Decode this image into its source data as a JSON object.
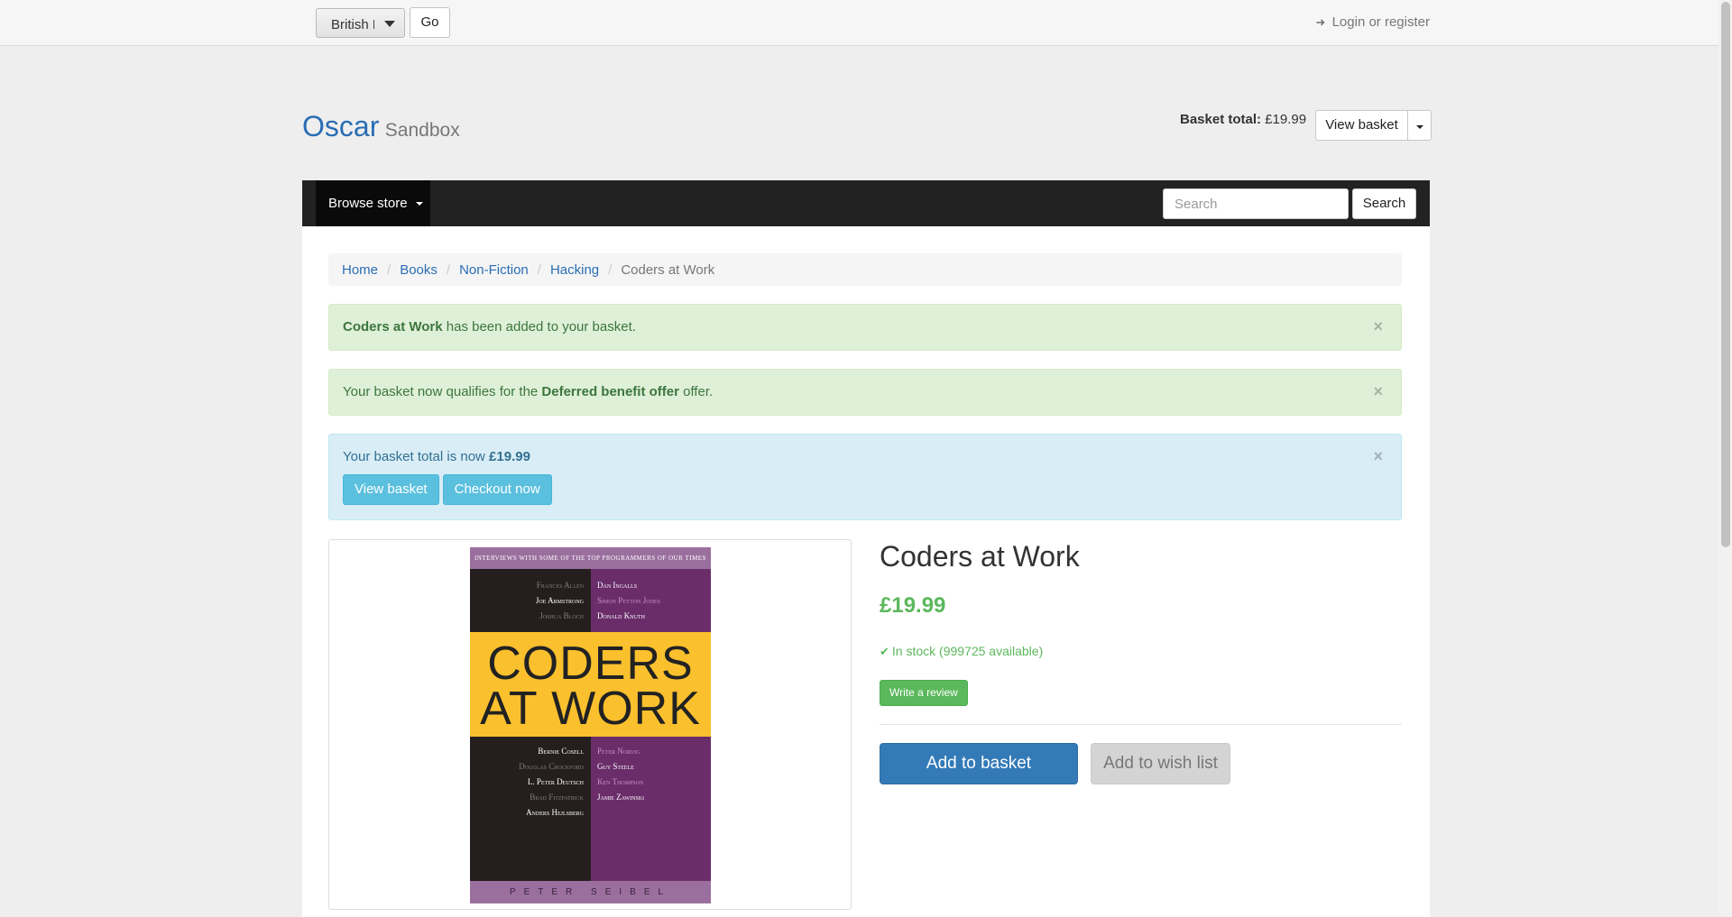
{
  "topbar": {
    "language_value": "British E",
    "go_label": "Go",
    "login_label": "Login or register"
  },
  "brand": {
    "name": "Oscar",
    "sub": "Sandbox"
  },
  "basket": {
    "total_label": "Basket total:",
    "total_value": "£19.99",
    "view_basket_label": "View basket"
  },
  "nav": {
    "browse_label": "Browse store",
    "search_placeholder": "Search",
    "search_button": "Search"
  },
  "breadcrumb": {
    "items": [
      "Home",
      "Books",
      "Non-Fiction",
      "Hacking"
    ],
    "active": "Coders at Work"
  },
  "alerts": {
    "added": {
      "strong": "Coders at Work",
      "text": " has been added to your basket."
    },
    "offer": {
      "pre": "Your basket now qualifies for the ",
      "strong": "Deferred benefit offer",
      "post": " offer."
    },
    "total": {
      "pre": "Your basket total is now ",
      "strong": "£19.99",
      "view_basket": "View basket",
      "checkout": "Checkout now"
    },
    "close": "×"
  },
  "cover": {
    "tagline": "INTERVIEWS WITH SOME OF THE TOP PROGRAMMERS OF OUR TIMES",
    "top_left": [
      "Frances Allen",
      "Joe Armstrong",
      "Joshua Bloch"
    ],
    "top_right": [
      "Dan Ingalls",
      "Simon Peyton Jones",
      "Donald Knuth"
    ],
    "title_line1": "CODERS",
    "title_line2": "AT WORK",
    "bottom_left": [
      "Bernie Cosell",
      "Douglas Crockford",
      "L. Peter Deutsch",
      "Brad Fitzpatrick",
      "Anders Hejlsberg"
    ],
    "bottom_right": [
      "Peter Norvig",
      "Guy Steele",
      "Ken Thompson",
      "Jamie Zawinski"
    ],
    "author": "PETER SEIBEL"
  },
  "product": {
    "title": "Coders at Work",
    "price": "£19.99",
    "availability": "In stock (999725 available)",
    "write_review": "Write a review",
    "add_to_basket": "Add to basket",
    "add_to_wishlist": "Add to wish list"
  },
  "colors": {
    "link": "#2a6db3",
    "success": "#5cb85c",
    "primary": "#337ab7",
    "info": "#5bc0de",
    "navbar": "#222222"
  },
  "icons": {
    "login": "sign-in-icon",
    "stock": "check-icon"
  }
}
